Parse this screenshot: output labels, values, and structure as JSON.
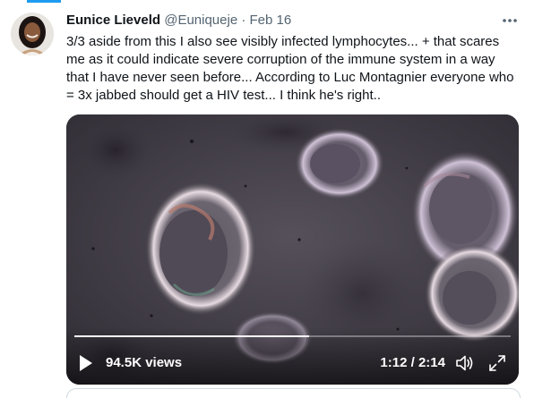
{
  "tweet": {
    "author_name": "Eunice Lieveld",
    "handle": "@Euniqueje",
    "separator": "·",
    "date": "Feb 16",
    "text_lines": [
      "3/3 aside from this I also see visibly infected lymphocytes... + that scares",
      "me as it could indicate severe corruption of the immune system in a way",
      "that I have never seen before... According to Luc Montagnier everyone who",
      "= 3x jabbed should get a HIV test... I think he's right.."
    ]
  },
  "video": {
    "views": "94.5K views",
    "current_time": "1:12",
    "time_separator": "/",
    "duration": "2:14",
    "progress": 0.537
  },
  "icons": {
    "more": "more-horizontal-icon",
    "play": "play-icon",
    "volume": "volume-icon",
    "fullscreen": "fullscreen-icon"
  },
  "colors": {
    "accent": "#1d9bf0",
    "text_primary": "#0f1419",
    "text_secondary": "#536471"
  }
}
